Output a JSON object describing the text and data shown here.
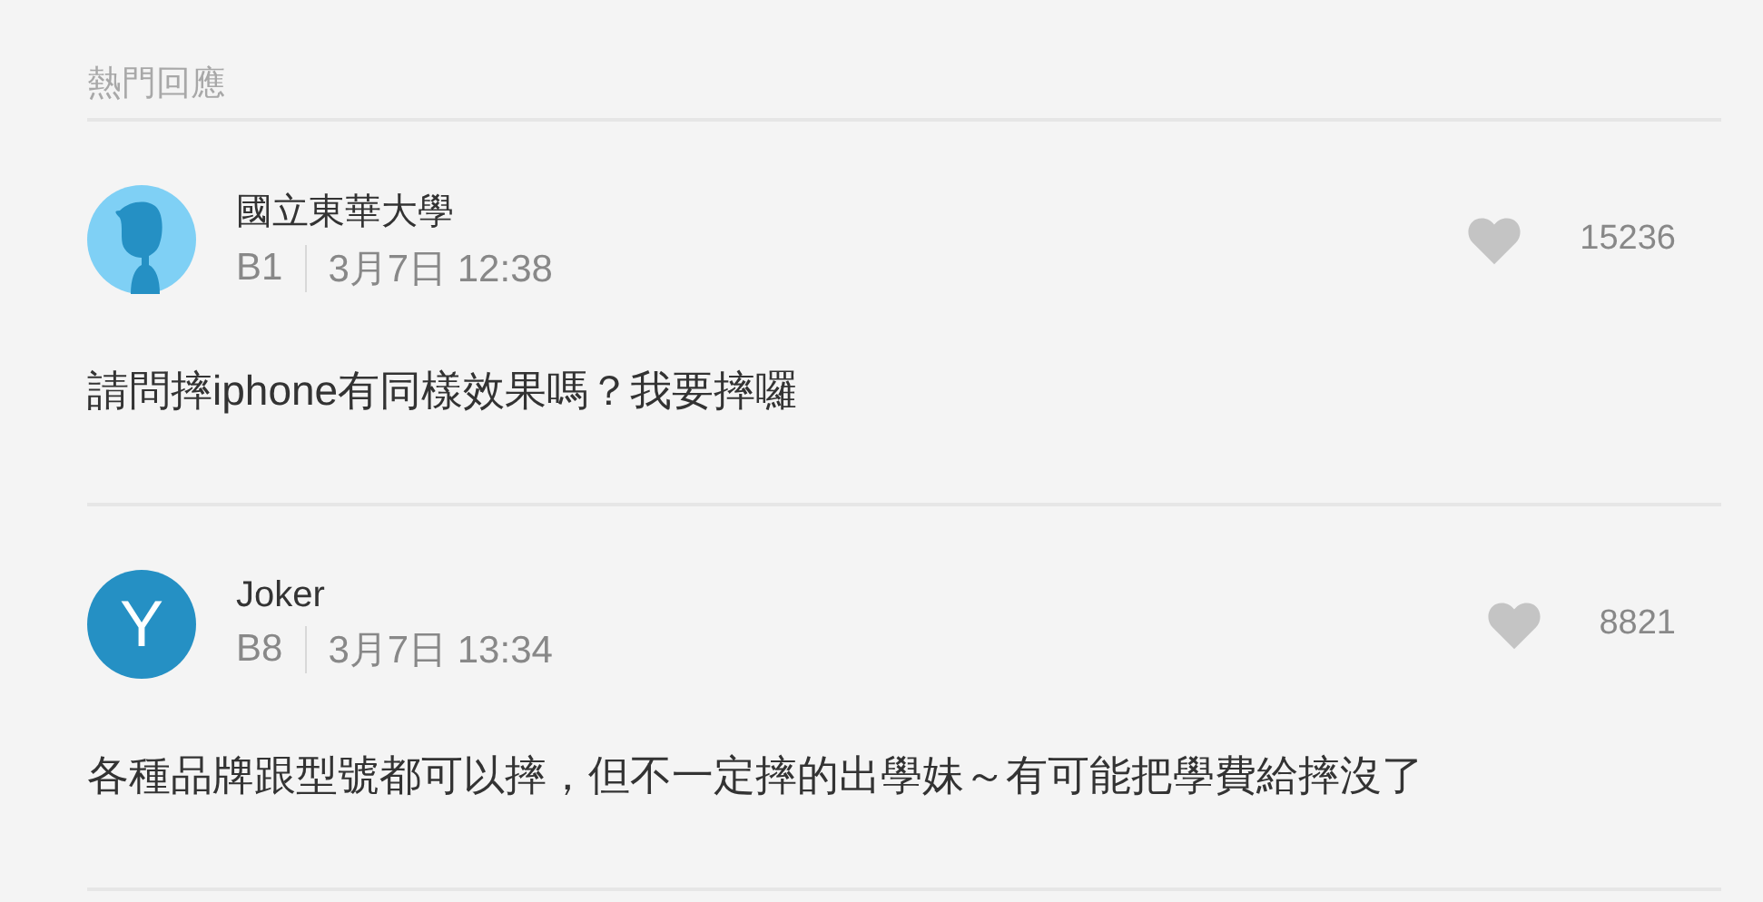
{
  "section_title": "熱門回應",
  "comments": [
    {
      "avatar": {
        "kind": "silhouette"
      },
      "author": "國立東華大學",
      "floor": "B1",
      "time": "3月7日 12:38",
      "likes": "15236",
      "content": "請問摔iphone有同樣效果嗎？我要摔囉"
    },
    {
      "avatar": {
        "kind": "letter",
        "letter": "Y"
      },
      "author": "Joker",
      "floor": "B8",
      "time": "3月7日 13:34",
      "likes": "8821",
      "content": "各種品牌跟型號都可以摔，但不一定摔的出學妹～有可能把學費給摔沒了"
    }
  ]
}
